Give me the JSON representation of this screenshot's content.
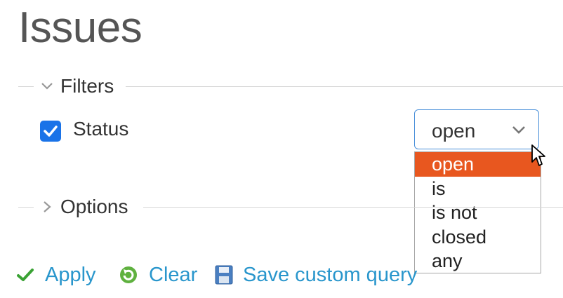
{
  "page": {
    "title": "Issues"
  },
  "filters": {
    "legend": "Filters",
    "status": {
      "label": "Status",
      "checked": true,
      "selected_value": "open",
      "options": [
        "open",
        "is",
        "is not",
        "closed",
        "any"
      ],
      "highlighted_option": "open"
    }
  },
  "options": {
    "legend": "Options"
  },
  "actions": {
    "apply": "Apply",
    "clear": "Clear",
    "save": "Save custom query"
  },
  "colors": {
    "link": "#2996cc",
    "highlight": "#e8571f",
    "checkbox": "#1a73e8",
    "select_border": "#4a90d9",
    "apply_icon": "#3aa234"
  }
}
